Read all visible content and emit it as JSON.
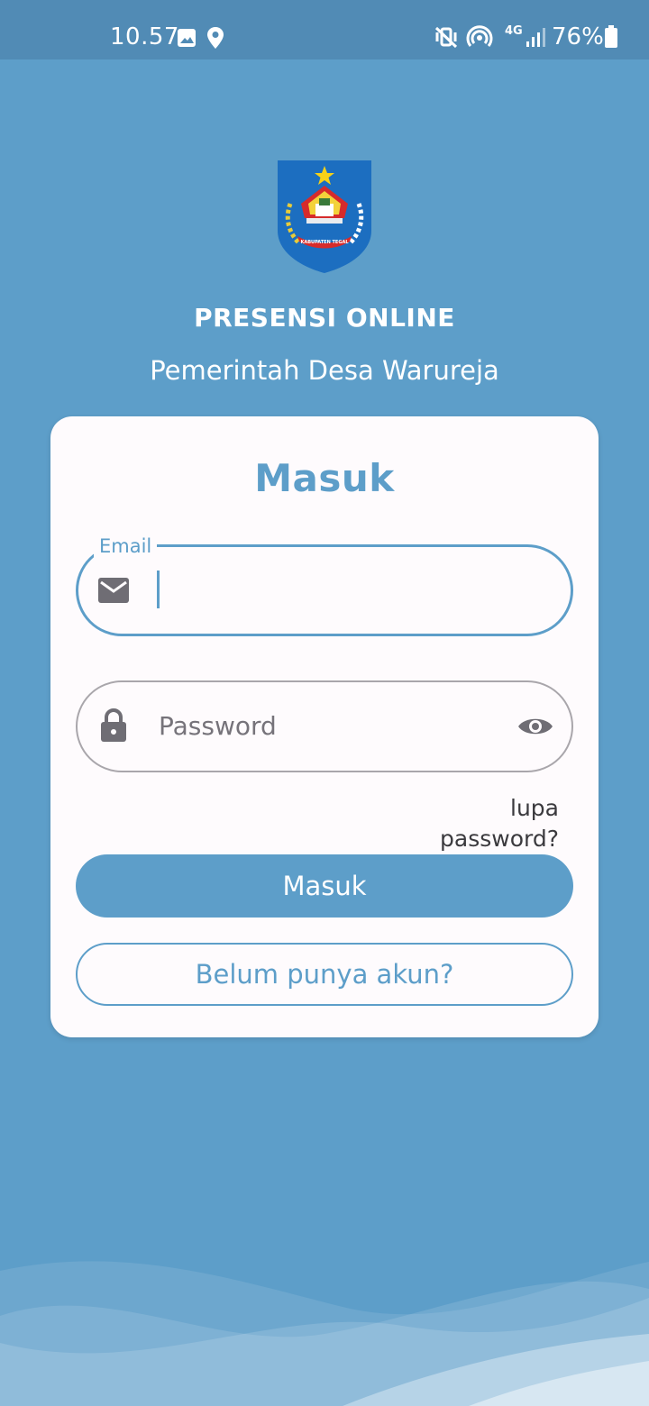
{
  "status_bar": {
    "time": "10.57",
    "battery": "76%",
    "icons": [
      "image-icon",
      "location-pin-icon",
      "mute-vibrate-icon",
      "hotspot-icon",
      "4g-icon",
      "signal-icon",
      "battery-icon"
    ],
    "network_label": "4G"
  },
  "header": {
    "logo": "kabupaten-tegal-crest",
    "logo_text": "KABUPATEN TEGAL",
    "title": "PRESENSI ONLINE",
    "subtitle": "Pemerintah Desa Warureja"
  },
  "login_card": {
    "title": "Masuk",
    "email": {
      "label": "Email",
      "value": "",
      "icon": "mail-icon"
    },
    "password": {
      "placeholder": "Password",
      "icon": "lock-icon",
      "toggle_icon": "eye-icon"
    },
    "forgot_link": "lupa password?",
    "login_button": "Masuk",
    "register_button": "Belum punya akun?"
  },
  "colors": {
    "background": "#5d9ec9",
    "status_bar": "#518bb5",
    "card": "#fefbfd",
    "accent": "#5d9ec9"
  }
}
